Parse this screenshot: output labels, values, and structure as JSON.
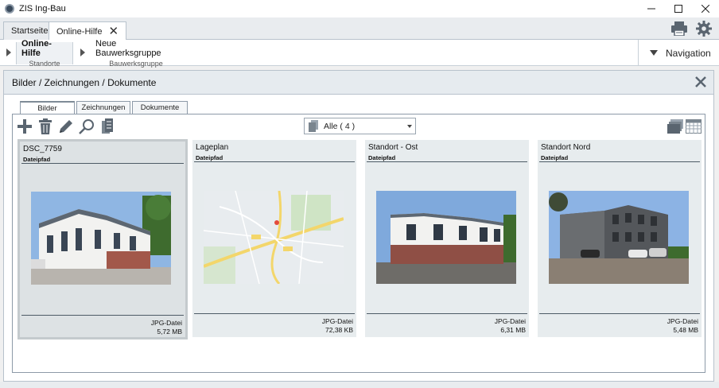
{
  "window": {
    "title": "ZIS Ing-Bau"
  },
  "tabs": [
    {
      "label": "Startseite",
      "active": false
    },
    {
      "label": "Online-Hilfe",
      "active": true
    }
  ],
  "breadcrumb": [
    {
      "title": "Online-Hilfe",
      "subtitle": "Standorte",
      "active": true
    },
    {
      "title": "Neue Bauwerksgruppe",
      "subtitle": "Bauwerksgruppe",
      "active": false
    }
  ],
  "navigation": {
    "label": "Navigation"
  },
  "panel": {
    "title": "Bilder / Zeichnungen / Dokumente",
    "subtabs": [
      {
        "label": "Bilder",
        "active": true
      },
      {
        "label": "Zeichnungen",
        "active": false
      },
      {
        "label": "Dokumente",
        "active": false
      }
    ],
    "filter": {
      "selected": "Alle ( 4 )"
    },
    "cards": [
      {
        "title": "DSC_7759",
        "path_label": "Dateipfad",
        "type": "JPG-Datei",
        "size": "5,72 MB",
        "selected": true,
        "image": "building-photo"
      },
      {
        "title": "Lageplan",
        "path_label": "Dateipfad",
        "type": "JPG-Datei",
        "size": "72,38 KB",
        "selected": false,
        "image": "map"
      },
      {
        "title": "Standort - Ost",
        "path_label": "Dateipfad",
        "type": "JPG-Datei",
        "size": "6,31 MB",
        "selected": false,
        "image": "building-photo"
      },
      {
        "title": "Standort Nord",
        "path_label": "Dateipfad",
        "type": "JPG-Datei",
        "size": "5,48 MB",
        "selected": false,
        "image": "building-photo"
      }
    ]
  },
  "colors": {
    "accent": "#4d5b66",
    "card_bg": "#e7ecee",
    "header_bg": "#e6ebef"
  }
}
